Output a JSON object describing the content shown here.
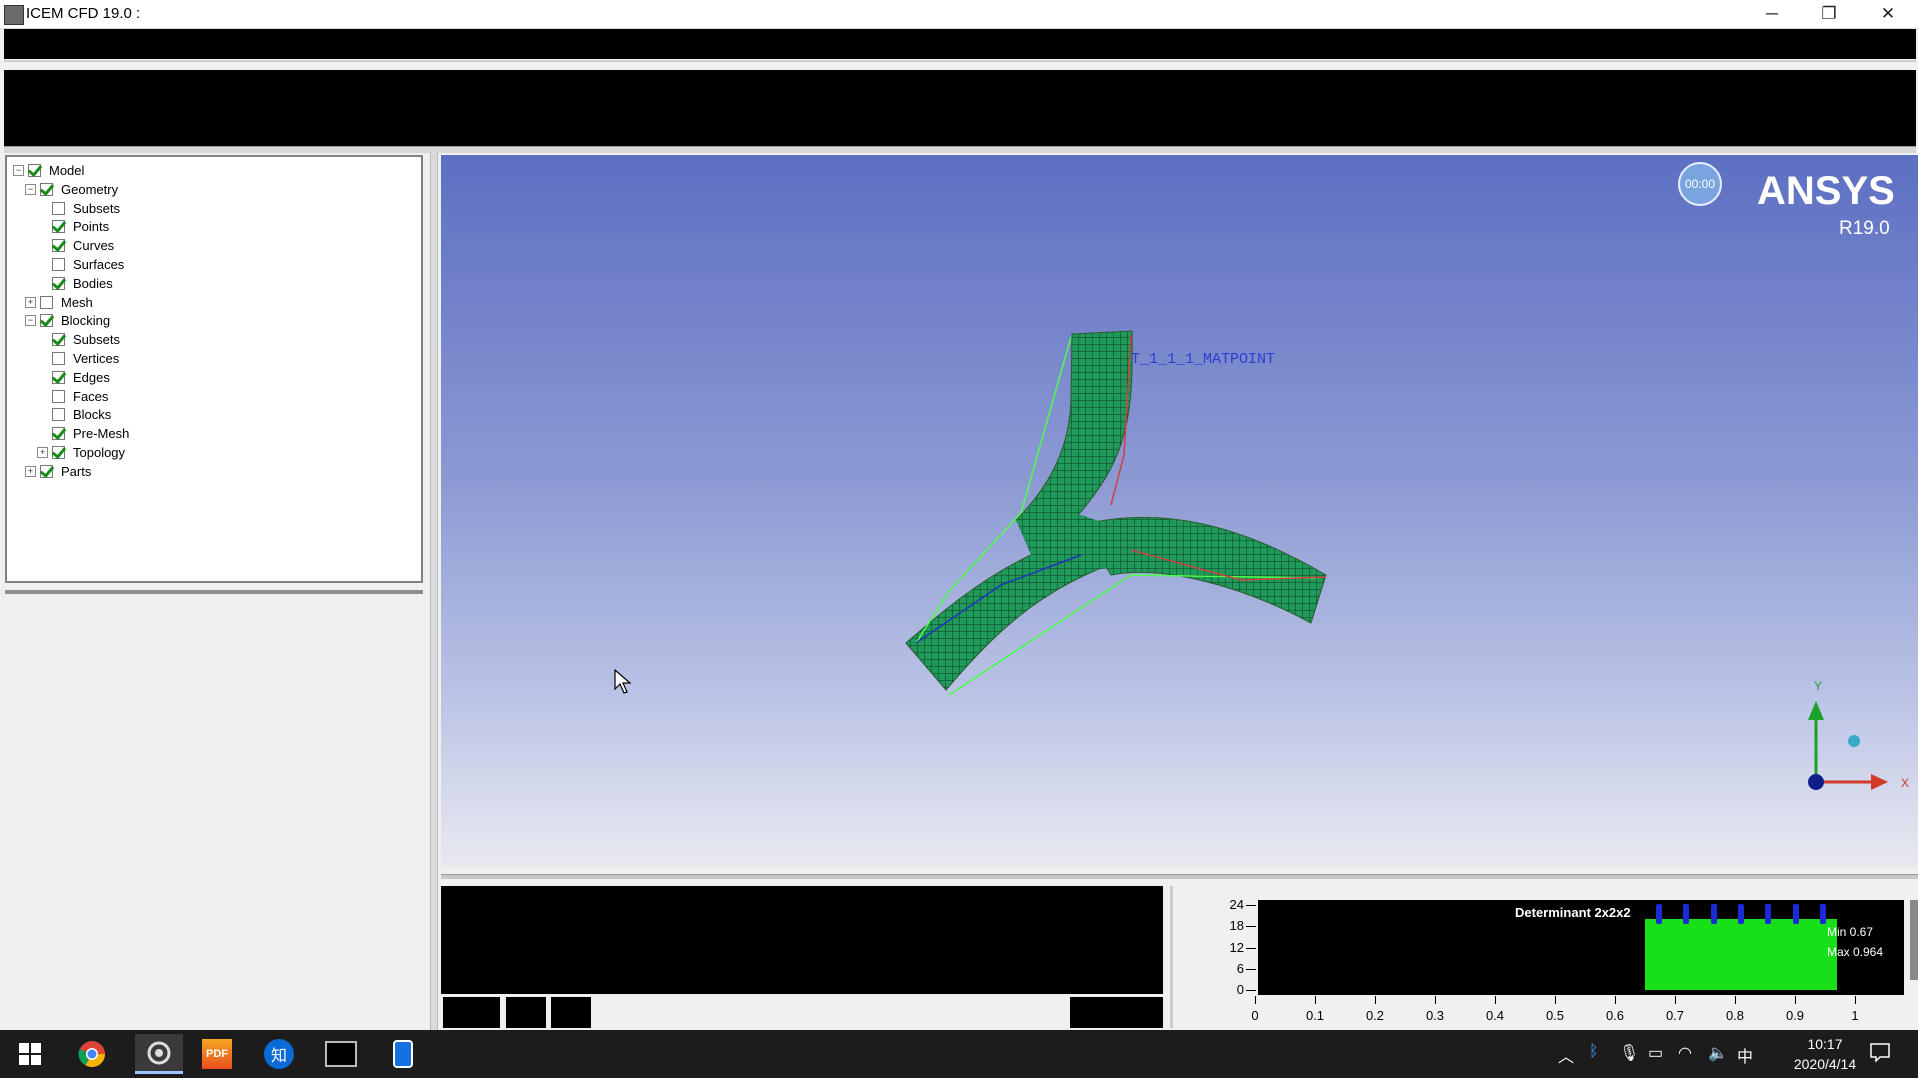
{
  "window": {
    "title": "ICEM CFD 19.0 :",
    "minimize": "─",
    "restore": "❐",
    "close": "✕"
  },
  "tree": {
    "items": [
      {
        "label": "Model",
        "level": 0,
        "expander": "−",
        "checked": true
      },
      {
        "label": "Geometry",
        "level": 1,
        "expander": "−",
        "checked": true
      },
      {
        "label": "Subsets",
        "level": 2,
        "checked": false
      },
      {
        "label": "Points",
        "level": 2,
        "checked": true
      },
      {
        "label": "Curves",
        "level": 2,
        "checked": true
      },
      {
        "label": "Surfaces",
        "level": 2,
        "checked": false
      },
      {
        "label": "Bodies",
        "level": 2,
        "checked": true
      },
      {
        "label": "Mesh",
        "level": 1,
        "expander": "+",
        "checked": false
      },
      {
        "label": "Blocking",
        "level": 1,
        "expander": "−",
        "checked": true
      },
      {
        "label": "Subsets",
        "level": 2,
        "checked": true
      },
      {
        "label": "Vertices",
        "level": 2,
        "checked": false
      },
      {
        "label": "Edges",
        "level": 2,
        "checked": true
      },
      {
        "label": "Faces",
        "level": 2,
        "checked": false
      },
      {
        "label": "Blocks",
        "level": 2,
        "checked": false
      },
      {
        "label": "Pre-Mesh",
        "level": 2,
        "checked": true
      },
      {
        "label": "Topology",
        "level": 2,
        "expander": "+",
        "checked": true
      },
      {
        "label": "Parts",
        "level": 1,
        "expander": "+",
        "checked": true
      }
    ]
  },
  "viewport": {
    "timer": "00:00",
    "brand": "ANSYS",
    "version": "R19.0",
    "label_matpoint": "T_1_1_1_MATPOINT",
    "axis_y": "Y",
    "axis_x": "X",
    "mesh_color": "#1f9a5a",
    "accent_colors": {
      "x_axis": "#d23a2a",
      "y_axis": "#1aa12a",
      "z_axis": "#10208a"
    }
  },
  "histogram": {
    "title": "Determinant 2x2x2",
    "min_label": "Min 0.67",
    "max_label": "Max 0.964",
    "y_ticks": [
      "24",
      "18",
      "12",
      "6",
      "0"
    ],
    "x_ticks": [
      "0",
      "0.1",
      "0.2",
      "0.3",
      "0.4",
      "0.5",
      "0.6",
      "0.7",
      "0.8",
      "0.9",
      "1"
    ],
    "bar_color": "#18e018",
    "range": [
      0.65,
      0.97
    ],
    "bar_level": 20
  },
  "taskbar": {
    "time": "10:17",
    "date": "2020/4/14",
    "ime": "中",
    "apps": [
      "start-icon",
      "chrome-icon",
      "icem-icon",
      "pdf-icon",
      "zhihu-icon",
      "terminal-icon",
      "tablet-icon"
    ],
    "pdf_label": "PDF",
    "zhihu_label": "知"
  }
}
